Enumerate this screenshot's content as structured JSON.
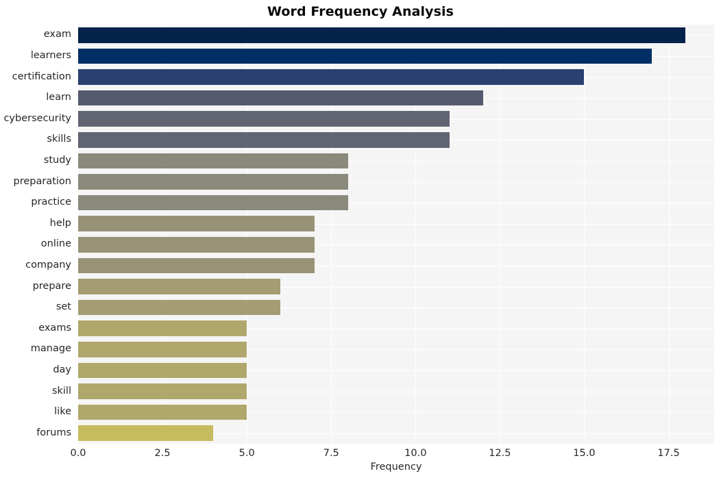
{
  "chart_data": {
    "type": "bar",
    "orientation": "horizontal",
    "title": "Word Frequency Analysis",
    "xlabel": "Frequency",
    "ylabel": "",
    "categories": [
      "exam",
      "learners",
      "certification",
      "learn",
      "cybersecurity",
      "skills",
      "study",
      "preparation",
      "practice",
      "help",
      "online",
      "company",
      "prepare",
      "set",
      "exams",
      "manage",
      "day",
      "skill",
      "like",
      "forums"
    ],
    "values": [
      18,
      17,
      15,
      12,
      11,
      11,
      8,
      8,
      8,
      7,
      7,
      7,
      6,
      6,
      5,
      5,
      5,
      5,
      5,
      4
    ],
    "bar_colors": [
      "#05224a",
      "#012f65",
      "#2a4070",
      "#555a6e",
      "#616472",
      "#616472",
      "#8a897b",
      "#8a897b",
      "#8a897b",
      "#989377",
      "#989377",
      "#989377",
      "#a49c72",
      "#a49c72",
      "#b0a76d",
      "#b0a76d",
      "#b0a76d",
      "#b0a76d",
      "#b0a76d",
      "#c6bb5f"
    ],
    "xticks": [
      0.0,
      2.5,
      5.0,
      7.5,
      10.0,
      12.5,
      15.0,
      17.5
    ],
    "xtick_labels": [
      "0.0",
      "2.5",
      "5.0",
      "7.5",
      "10.0",
      "12.5",
      "15.0",
      "17.5"
    ],
    "xlim": [
      0,
      18.85
    ],
    "grid": true,
    "grid_axis": "both",
    "legend": false,
    "plot_background": "#f5f5f5",
    "grid_color": "#ffffff",
    "figure_background": "#ffffff",
    "text_color": "#262626",
    "title_color": "#0a0a0a"
  }
}
